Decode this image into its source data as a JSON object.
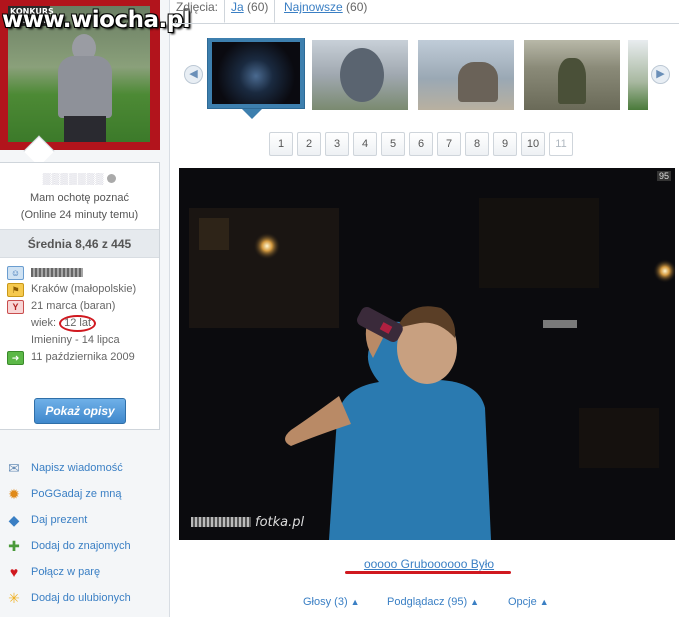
{
  "watermark": "www.wiocha.pl",
  "profile": {
    "photo_tag": "KONKURS TOSHIBA",
    "want_to_meet": "Mam ochotę poznać",
    "online_status": "(Online 24 minuty temu)",
    "average": "Średnia 8,46 z 445",
    "location": "Kraków (małopolskie)",
    "birthday": "21 marca (baran)",
    "age_prefix": "wiek: ",
    "age": "12 lat",
    "name_day": "Imieniny - 14 lipca",
    "joined": "11 października 2009",
    "show_descriptions_button": "Pokaż opisy"
  },
  "actions": [
    {
      "label": "Napisz wiadomość",
      "icon": "envelope-icon"
    },
    {
      "label": "PoGGadaj ze mną",
      "icon": "sun-icon"
    },
    {
      "label": "Daj prezent",
      "icon": "gift-icon"
    },
    {
      "label": "Dodaj do znajomych",
      "icon": "add-friend-icon"
    },
    {
      "label": "Połącz w parę",
      "icon": "heart-icon"
    },
    {
      "label": "Dodaj do ulubionych",
      "icon": "star-icon"
    }
  ],
  "tabs": {
    "label": "Zdjęcia:",
    "items": [
      {
        "name": "Ja",
        "count": "(60)"
      },
      {
        "name": "Najnowsze",
        "count": "(60)"
      }
    ]
  },
  "pagination": [
    "1",
    "2",
    "3",
    "4",
    "5",
    "6",
    "7",
    "8",
    "9",
    "10",
    "11"
  ],
  "photo": {
    "number_badge": "95",
    "credit": "fotka.pl",
    "caption": "ooooo Gruboooooo Było"
  },
  "bottom_links": [
    {
      "label": "Głosy (3)"
    },
    {
      "label": "Podglądacz (95)"
    },
    {
      "label": "Opcje"
    }
  ],
  "colors": {
    "link_blue": "#3a7fc4",
    "selected_thumb_border": "#3d7fae",
    "annotation_red": "#d0181f",
    "profile_frame_red": "#b2141c"
  }
}
